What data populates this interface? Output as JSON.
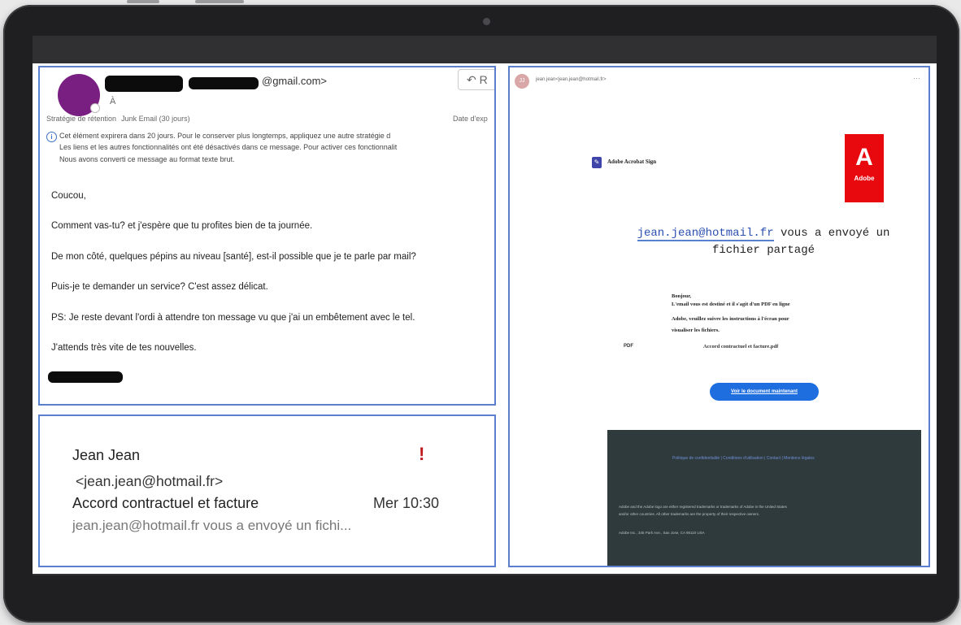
{
  "email": {
    "sender_domain": "@gmail.com>",
    "to_label": "À",
    "reply_label": "R",
    "retention_label": "Stratégie de rétention",
    "retention_value": "Junk Email (30 jours)",
    "date_label": "Date d'exp",
    "info_lines": [
      "Cet élément expirera dans 20 jours. Pour le conserver plus longtemps, appliquez une autre stratégie d",
      "Les liens et les autres fonctionnalités ont été désactivés dans ce message. Pour activer ces fonctionnalit",
      "Nous avons converti ce message au format texte brut."
    ],
    "body_lines": [
      "Coucou,",
      "Comment vas-tu? et j'espère que tu profites bien de ta journée.",
      "De mon côté, quelques pépins au niveau [santé], est-il possible que je te parle par mail?",
      " Puis-je te demander un service? C'est assez délicat.",
      "PS: Je reste devant l'ordi à attendre ton message vu que j'ai un embêtement avec le tel.",
      "J'attends très vite de tes nouvelles."
    ]
  },
  "inbox_item": {
    "sender_name": "Jean Jean",
    "sender_email": "<jean.jean@hotmail.fr>",
    "subject": "Accord contractuel et facture",
    "time": "Mer 10:30",
    "preview": "jean.jean@hotmail.fr vous a envoyé un fichi...",
    "flag": "!"
  },
  "adobe_page": {
    "sender_line": "jean.jean<jean.jean@hotmail.fr>",
    "brand_name": "Adobe Acrobat Sign",
    "logo_word": "Adobe",
    "headline_email": "jean.jean@hotmail.fr",
    "headline_rest": " vous a envoyé un fichier partagé",
    "message_lines": [
      "Bonjour,",
      "L'email vous est destiné et il s'agit d'un PDF en ligne",
      "Adobe, veuillez suivre les instructions à l'écran pour",
      "visualiser les fichiers."
    ],
    "file_label": "PDF",
    "file_name": "Accord contractuel et facture.pdf",
    "view_button": "Voir le document maintenant",
    "footer_links": "Politique de confidentialité | Conditions d'utilisation | Contact | Mentions légales",
    "footer_text_1": "Adobe and the Adobe logo are either registered trademarks or trademarks of Adobe in the United States",
    "footer_text_2": "and/or other countries. All other trademarks are the property of their respective owners.",
    "footer_address": "Adobe Inc., 345 Park Ave., San Jose, CA 95110 USA"
  }
}
